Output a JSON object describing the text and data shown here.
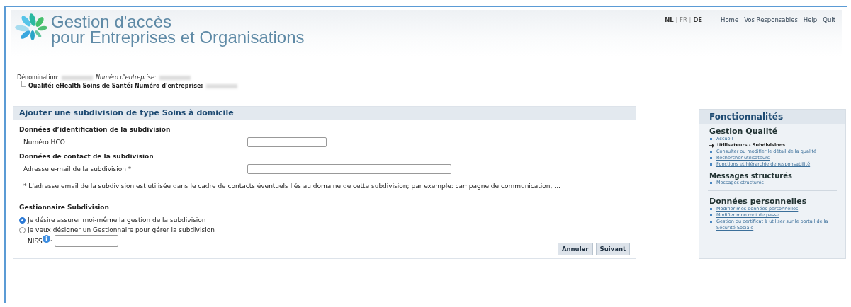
{
  "header": {
    "title_line_1": "Gestion d'accès",
    "title_line_2": "pour Entreprises et Organisations",
    "languages": [
      {
        "label": "NL",
        "selected": false
      },
      {
        "label": "FR",
        "selected": true
      },
      {
        "label": "DE",
        "selected": false
      }
    ],
    "language_separators": [
      "|",
      "|"
    ],
    "links": [
      "Home",
      "Vos Responsables",
      "Help",
      "Quit"
    ]
  },
  "identity": {
    "name_label": "Dénomination:",
    "number_label": "Numéro d'entreprise:",
    "quality": "Qualité: eHealth Soins de Santé; Numéro d'entreprise:"
  },
  "form": {
    "title": "Ajouter une subdivision de type Soins à domicile",
    "sections": [
      {
        "heading": "Données d’identification de la subdivision",
        "fields": [
          {
            "label": "Numéro HCO",
            "colon": ":",
            "kind": "short"
          }
        ]
      },
      {
        "heading": "Données de contact de la subdivision",
        "fields": [
          {
            "label": "Adresse e-mail de la subdivision *",
            "colon": ":",
            "kind": "long"
          }
        ]
      }
    ],
    "note": "* L'adresse email de la subdivision est utilisée dans le cadre de contacts éventuels liés au domaine de cette subdivision; par exemple: campagne de communication, ...",
    "manager_heading": "Gestionnaire Subdivision",
    "options": [
      {
        "label": "Je désire assurer moi-même la gestion de la subdivision",
        "selected": true
      },
      {
        "label": "Je veux désigner un Gestionnaire pour gérer la subdivision",
        "selected": false
      }
    ],
    "niss_label": "NISS",
    "niss_colon": ":",
    "buttons": [
      "Annuler",
      "Suivant"
    ]
  },
  "sidebar": {
    "title": "Fonctionnalités",
    "groups": [
      {
        "heading": "Gestion Qualité",
        "items": [
          {
            "label": "Accueil",
            "selected": false
          },
          {
            "label": "Utilisateurs - Subdivisions",
            "selected": true
          },
          {
            "label": "Consulter ou modifier le détail de la qualité",
            "selected": false
          },
          {
            "label": "Rechercher utilisateurs",
            "selected": false
          },
          {
            "label": "Fonctions et hiérarchie de responsabilité",
            "selected": false
          }
        ]
      },
      {
        "heading": "Messages structurés",
        "items": [
          {
            "label": "Messages structurés",
            "selected": false
          }
        ]
      },
      {
        "heading": "Données personnelles",
        "items": [
          {
            "label": "Modifier mes données personnelles",
            "selected": false
          },
          {
            "label": "Modifier mon mot de passe",
            "selected": false
          },
          {
            "label": "Gestion du certificat à utiliser sur le portail de la Sécurité Sociale",
            "selected": false
          }
        ]
      }
    ]
  }
}
